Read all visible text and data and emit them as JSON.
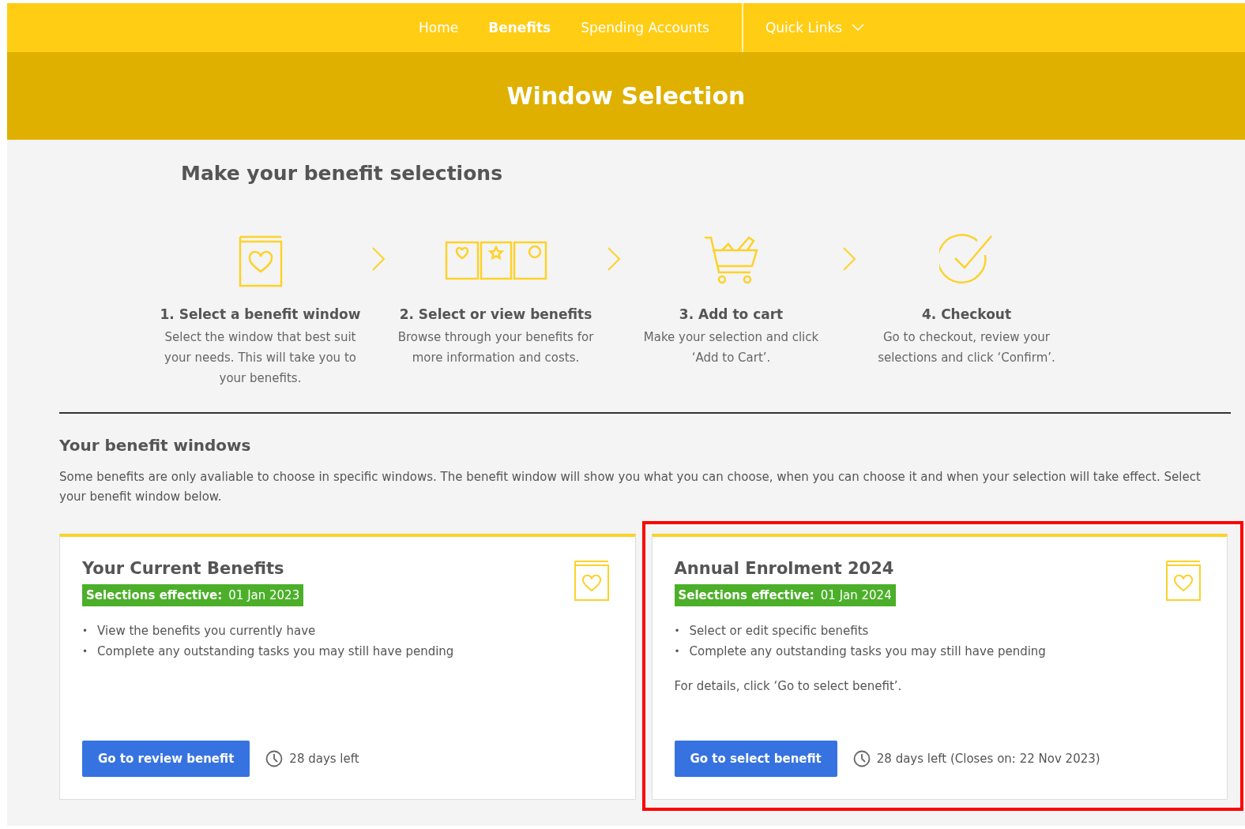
{
  "nav": {
    "items": [
      {
        "label": "Home",
        "selected": false
      },
      {
        "label": "Benefits",
        "selected": true
      },
      {
        "label": "Spending Accounts",
        "selected": false
      }
    ],
    "quick_links": "Quick Links"
  },
  "page_title": "Window Selection",
  "heading": "Make your benefit selections",
  "steps": [
    {
      "kind": "book",
      "title": "1. Select a benefit window",
      "text": "Select the window that best suit your needs. This will take you to your benefits."
    },
    {
      "kind": "cards",
      "title": "2. Select or view benefits",
      "text": "Browse through your benefits for more information and costs."
    },
    {
      "kind": "cart",
      "title": "3. Add to cart",
      "text": "Make your selection and click ‘Add to Cart’."
    },
    {
      "kind": "check",
      "title": "4. Checkout",
      "text": "Go to checkout, review your selections and click ‘Confirm’."
    }
  ],
  "windows_section": {
    "title": "Your benefit windows",
    "description": "Some benefits are only avaliable to choose in specific windows. The benefit window will show you what you can choose, when you can choose it and when your selection will take effect. Select your benefit window below."
  },
  "cards": [
    {
      "title": "Your Current Benefits",
      "badge_label": "Selections effective:",
      "badge_date": "01 Jan 2023",
      "bullets": [
        {
          "marker": "•",
          "text": "View the benefits you currently have"
        },
        {
          "marker": "•",
          "text": "Complete any outstanding tasks you may still have pending"
        }
      ],
      "button": "Go to review benefit",
      "time_left": "28 days left",
      "highlighted": false
    },
    {
      "title": "Annual Enrolment 2024",
      "badge_label": "Selections effective:",
      "badge_date": "01 Jan 2024",
      "bullets": [
        {
          "marker": "•",
          "text": "Select or edit specific benefits"
        },
        {
          "marker": "•",
          "text": "Complete any outstanding tasks you may still have pending"
        }
      ],
      "note": "For details, click ‘Go to select benefit’.",
      "button": "Go to select benefit",
      "time_left": "28 days left (Closes on: 22 Nov 2023)",
      "highlighted": true
    }
  ]
}
